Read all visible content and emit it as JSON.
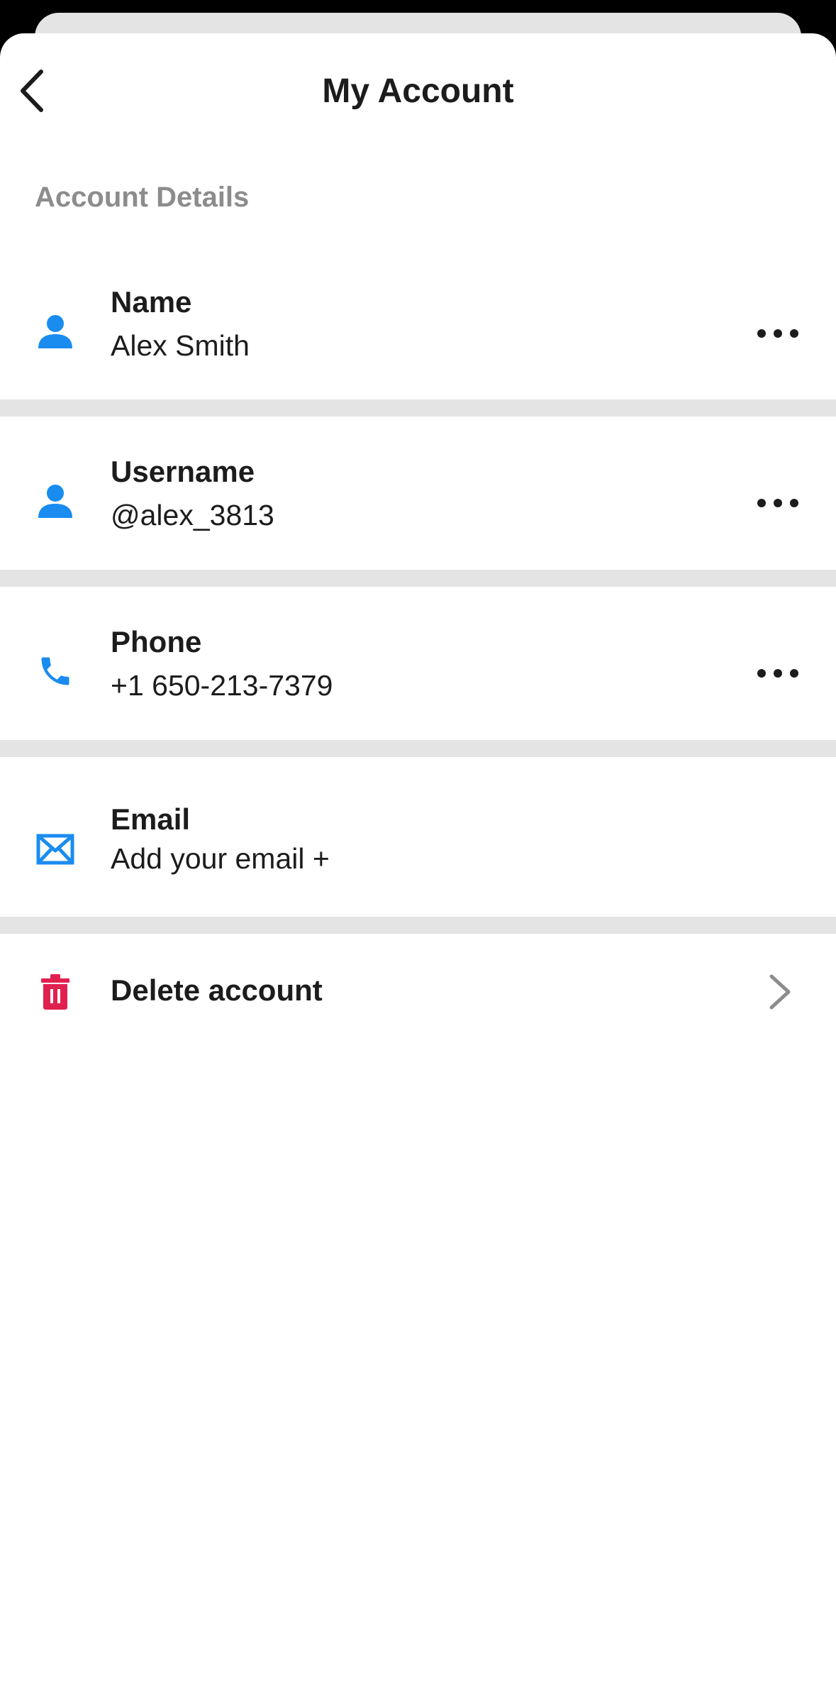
{
  "header": {
    "title": "My Account",
    "back_icon": "chevron-left-icon"
  },
  "section": {
    "label": "Account Details"
  },
  "rows": [
    {
      "id": "name",
      "icon": "person-icon",
      "title": "Name",
      "value": "Alex Smith",
      "action": "more-icon"
    },
    {
      "id": "username",
      "icon": "person-icon",
      "title": "Username",
      "value": "@alex_3813",
      "action": "more-icon"
    },
    {
      "id": "phone",
      "icon": "phone-icon",
      "title": "Phone",
      "value": "+1 650-213-7379",
      "action": "more-icon"
    },
    {
      "id": "email",
      "icon": "mail-icon",
      "title": "Email",
      "value": "Add your email +"
    }
  ],
  "delete": {
    "label": "Delete account",
    "icon": "trash-icon",
    "action": "chevron-right-icon"
  },
  "colors": {
    "accent_blue": "#1a8cf0",
    "danger_red": "#e0214f",
    "divider_gray": "#e4e4e4",
    "section_gray": "#8c8c8c"
  }
}
